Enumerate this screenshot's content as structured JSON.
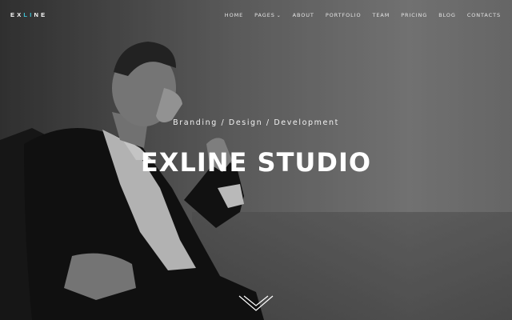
{
  "brand": {
    "logo_pre": "EX",
    "logo_accent": "LI",
    "logo_post": "NE",
    "accent_color": "#3ec3d6"
  },
  "nav": {
    "items": [
      {
        "label": "HOME"
      },
      {
        "label": "PAGES",
        "dropdown": true
      },
      {
        "label": "ABOUT"
      },
      {
        "label": "PORTFOLIO"
      },
      {
        "label": "TEAM"
      },
      {
        "label": "PRICING"
      },
      {
        "label": "BLOG"
      },
      {
        "label": "CONTACTS"
      }
    ]
  },
  "hero": {
    "tagline": "Branding / Design / Development",
    "title": "EXLINE STUDIO",
    "scroll_icon": "double-chevron-down-icon"
  }
}
